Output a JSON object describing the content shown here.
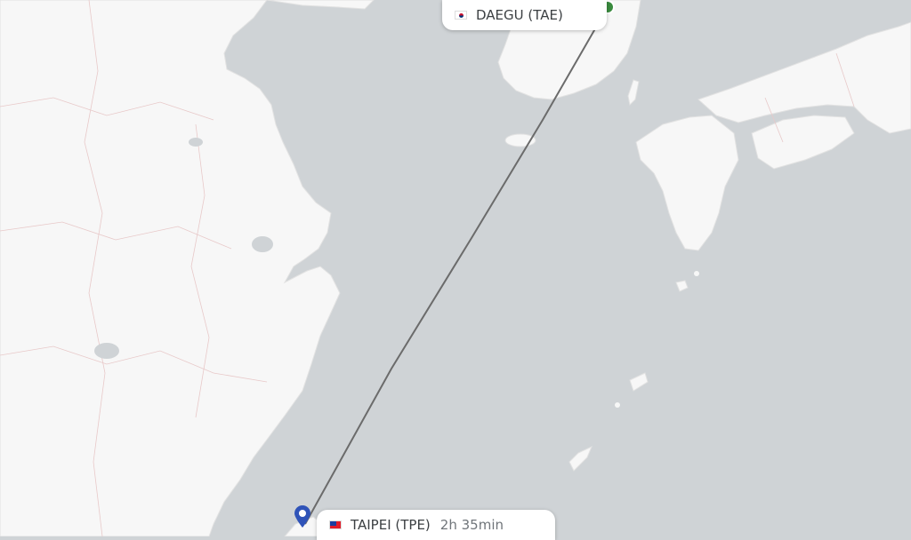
{
  "origin": {
    "city_code": "DAEGU (TAE)",
    "flag_icon": "south-korea-flag-icon",
    "marker_color": "#3a8b3f"
  },
  "destination": {
    "city_code": "TAIPEI (TPE)",
    "flag_icon": "taiwan-flag-icon",
    "marker_color": "#2f53b8"
  },
  "flight": {
    "duration": "2h 35min"
  },
  "colors": {
    "sea": "#cfd3d6",
    "land": "#f7f7f7",
    "route": "#6b6b6b"
  }
}
